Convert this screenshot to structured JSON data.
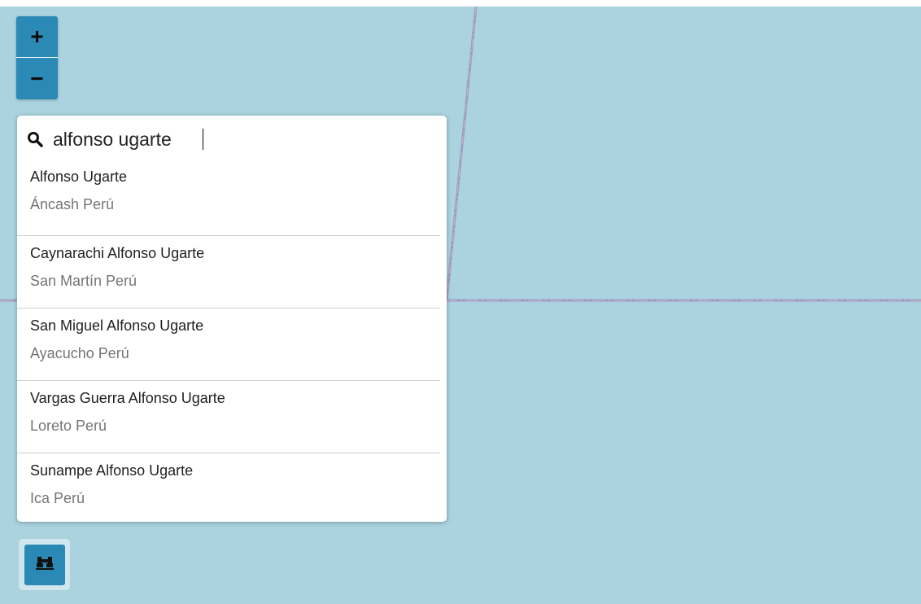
{
  "map": {
    "background_color": "#aad3df",
    "boundary_color": "#9b8db6"
  },
  "zoom": {
    "zoom_in_label": "+",
    "zoom_out_label": "−",
    "button_color": "#2b89b6"
  },
  "search": {
    "icon": "search-icon",
    "query": "alfonso ugarte",
    "results": [
      {
        "name": "Alfonso Ugarte",
        "region": "Áncash Perú"
      },
      {
        "name": "Caynarachi Alfonso Ugarte",
        "region": "San Martín Perú"
      },
      {
        "name": "San Miguel Alfonso Ugarte",
        "region": "Ayacucho Perú"
      },
      {
        "name": "Vargas Guerra Alfonso Ugarte",
        "region": "Loreto Perú"
      },
      {
        "name": "Sunampe Alfonso Ugarte",
        "region": "Ica Perú"
      }
    ]
  },
  "tools": {
    "binoculars_icon": "binoculars-icon"
  }
}
